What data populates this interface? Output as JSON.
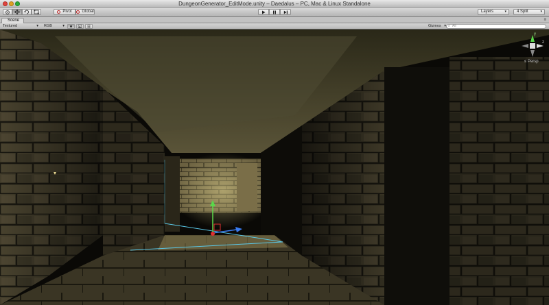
{
  "window": {
    "title": "DungeonGenerator_EditMode.unity – Daedalus – PC, Mac & Linux Standalone"
  },
  "toolbar": {
    "pivot_label": "Pivot",
    "global_label": "Global",
    "layers_label": "Layers",
    "layout_label": "4 Split"
  },
  "scene_tab": {
    "label": "Scene"
  },
  "scene_toolbar": {
    "render_mode": "Textured",
    "color_mode": "RGB",
    "gizmos_label": "Gizmos",
    "search_placeholder": "All"
  },
  "orientation_gizmo": {
    "projection_label": "Persp",
    "y_label": "y",
    "z_label": "z"
  },
  "colors": {
    "x_axis": "#e03030",
    "y_axis": "#5ad84a",
    "z_axis": "#3a7cf0",
    "selection_outline": "#5ac8e8"
  }
}
